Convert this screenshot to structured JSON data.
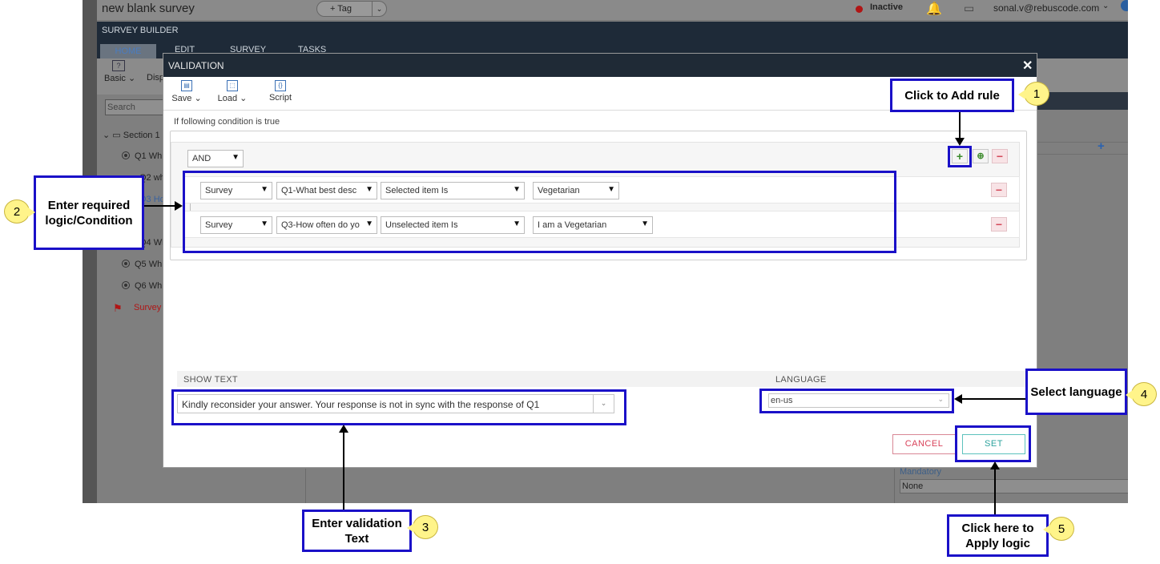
{
  "app": {
    "title": "new blank survey",
    "tag_label": "+ Tag",
    "status": "Inactive",
    "user": "sonal.v@rebuscode.com",
    "builder_label": "SURVEY BUILDER",
    "tabs": [
      "HOME",
      "EDIT",
      "SURVEY",
      "TASKS"
    ],
    "ribbon": {
      "basic": "Basic",
      "display": "Disp"
    },
    "search_placeholder": "Search",
    "tree": [
      "Section 1",
      "Q1 Wh",
      "Q2 wh",
      "Q3 Ho",
      "Q4 Wh",
      "Q5 Wh",
      "Q6 Wh"
    ],
    "tree_survey": "Survey",
    "mandatory_label": "Mandatory",
    "mandatory_value": "None"
  },
  "modal": {
    "title": "VALIDATION",
    "close": "✕",
    "toolbar": {
      "save": "Save",
      "load": "Load",
      "script": "Script"
    },
    "condition_label": "If following condition is true",
    "operator": "AND",
    "rules": [
      {
        "source": "Survey",
        "question": "Q1-What best desc",
        "comparator": "Selected item Is",
        "value": "Vegetarian"
      },
      {
        "source": "Survey",
        "question": "Q3-How often do yo",
        "comparator": "Unselected item Is",
        "value": "I am a Vegetarian"
      }
    ],
    "show_text_label": "SHOW TEXT",
    "language_label": "LANGUAGE",
    "show_text_value": "Kindly reconsider your answer. Your response is not in sync with the response of Q1",
    "language_value": "en-us",
    "cancel": "CANCEL",
    "set": "SET"
  },
  "annotations": {
    "a1": {
      "num": "1",
      "text": "Click to Add rule"
    },
    "a2": {
      "num": "2",
      "text": "Enter required logic/Condition"
    },
    "a3": {
      "num": "3",
      "text": "Enter validation Text"
    },
    "a4": {
      "num": "4",
      "text": "Select language"
    },
    "a5": {
      "num": "5",
      "text": "Click here to Apply logic"
    }
  },
  "colors": {
    "annotation_border": "#1a10c8",
    "badge": "#fff48a",
    "header": "#1f2a36",
    "set": "#2fa39e",
    "cancel": "#d9425a"
  }
}
